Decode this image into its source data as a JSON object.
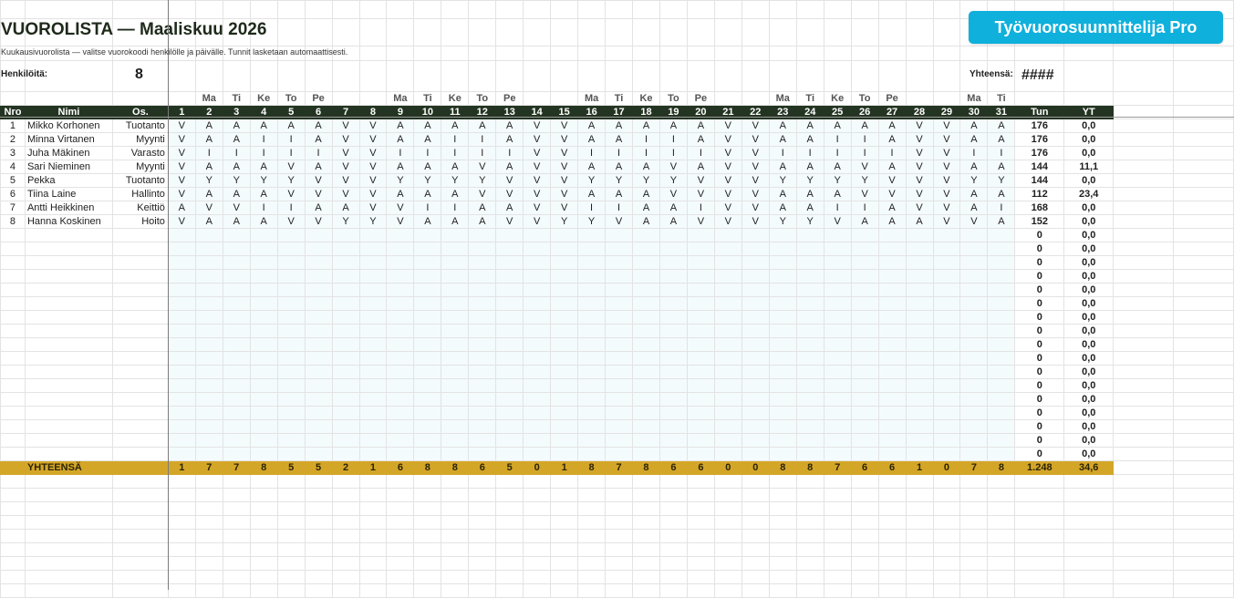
{
  "title": "VUOROLISTA — Maaliskuu 2026",
  "subtitle": "Kuukausivuorolista — valitse vuorokoodi henkilölle ja päivälle. Tunnit lasketaan automaattisesti.",
  "persons_label": "Henkilöitä:",
  "persons_count": "8",
  "total_label": "Yhteensä:",
  "total_value": "####",
  "brand_label": "Työvuorosuunnittelija Pro",
  "weekday_labels": [
    "",
    "Ma",
    "Ti",
    "Ke",
    "To",
    "Pe",
    "",
    "",
    "Ma",
    "Ti",
    "Ke",
    "To",
    "Pe",
    "",
    "",
    "Ma",
    "Ti",
    "Ke",
    "To",
    "Pe",
    "",
    "",
    "Ma",
    "Ti",
    "Ke",
    "To",
    "Pe",
    "",
    "",
    "Ma",
    "Ti"
  ],
  "headers": {
    "nro": "Nro",
    "name": "Nimi",
    "dept": "Os.",
    "days": [
      "1",
      "2",
      "3",
      "4",
      "5",
      "6",
      "7",
      "8",
      "9",
      "10",
      "11",
      "12",
      "13",
      "14",
      "15",
      "16",
      "17",
      "18",
      "19",
      "20",
      "21",
      "22",
      "23",
      "24",
      "25",
      "26",
      "27",
      "28",
      "29",
      "30",
      "31"
    ],
    "hours": "Tun",
    "yt": "YT"
  },
  "rows": [
    {
      "nro": "1",
      "name": "Mikko Korhonen",
      "dept": "Tuotanto",
      "shifts": "V A A A A A V V A A A A A V V A A A A A V V A A A A A V V A A",
      "hours": "176",
      "yt": "0,0"
    },
    {
      "nro": "2",
      "name": "Minna Virtanen",
      "dept": "Myynti",
      "shifts": "V A A I I A V V A A I I A V V A A I I A V V A A I I A V V A A",
      "hours": "176",
      "yt": "0,0"
    },
    {
      "nro": "3",
      "name": "Juha Mäkinen",
      "dept": "Varasto",
      "shifts": "V I I I I I V V I I I I I V V I I I I I V V I I I I I V V I I",
      "hours": "176",
      "yt": "0,0"
    },
    {
      "nro": "4",
      "name": "Sari Nieminen",
      "dept": "Myynti",
      "shifts": "V A A A V A V V A A A V A V V A A A V A V V A A A V A V V A A",
      "hours": "144",
      "yt": "11,1"
    },
    {
      "nro": "5",
      "name": "Pekka",
      "dept": "Tuotanto",
      "shifts": "V Y Y Y Y V V V Y Y Y Y V V V Y Y Y Y V V V Y Y Y Y V V V Y Y",
      "hours": "144",
      "yt": "0,0"
    },
    {
      "nro": "6",
      "name": "Tiina Laine",
      "dept": "Hallinto",
      "shifts": "V A A A V V V V A A A V V V V A A A V V V V A A A V V V V A A",
      "hours": "112",
      "yt": "23,4"
    },
    {
      "nro": "7",
      "name": "Antti Heikkinen",
      "dept": "Keittiö",
      "shifts": "A V V I I A A V V I I A A V V I I A A I V V A A I I A V V A I",
      "hours": "168",
      "yt": "0,0"
    },
    {
      "nro": "8",
      "name": "Hanna Koskinen",
      "dept": "Hoito",
      "shifts": "V A A A V V Y Y V A A A V V Y Y V A A V V V Y Y V A A A V V A",
      "hours": "152",
      "yt": "0,0"
    }
  ],
  "empty_rows": [
    {
      "hours": "0",
      "yt": "0,0"
    },
    {
      "hours": "0",
      "yt": "0,0"
    },
    {
      "hours": "0",
      "yt": "0,0"
    },
    {
      "hours": "0",
      "yt": "0,0"
    },
    {
      "hours": "0",
      "yt": "0,0"
    },
    {
      "hours": "0",
      "yt": "0,0"
    },
    {
      "hours": "0",
      "yt": "0,0"
    },
    {
      "hours": "0",
      "yt": "0,0"
    },
    {
      "hours": "0",
      "yt": "0,0"
    },
    {
      "hours": "0",
      "yt": "0,0"
    },
    {
      "hours": "0",
      "yt": "0,0"
    },
    {
      "hours": "0",
      "yt": "0,0"
    },
    {
      "hours": "0",
      "yt": "0,0"
    },
    {
      "hours": "0",
      "yt": "0,0"
    },
    {
      "hours": "0",
      "yt": "0,0"
    },
    {
      "hours": "0",
      "yt": "0,0"
    },
    {
      "hours": "0",
      "yt": "0,0"
    }
  ],
  "totals": {
    "label": "YHTEENSÄ",
    "days": [
      "1",
      "7",
      "7",
      "8",
      "5",
      "5",
      "2",
      "1",
      "6",
      "8",
      "8",
      "6",
      "5",
      "0",
      "1",
      "8",
      "7",
      "8",
      "6",
      "6",
      "0",
      "0",
      "8",
      "8",
      "7",
      "6",
      "6",
      "1",
      "0",
      "7",
      "8"
    ],
    "hours": "1.248",
    "yt": "34,6"
  },
  "colors": {
    "header_bg": "#243422",
    "total_bg": "#d4a628",
    "brand_bg": "#0fb0dc",
    "schedule_bg": "#f4fbfd"
  }
}
